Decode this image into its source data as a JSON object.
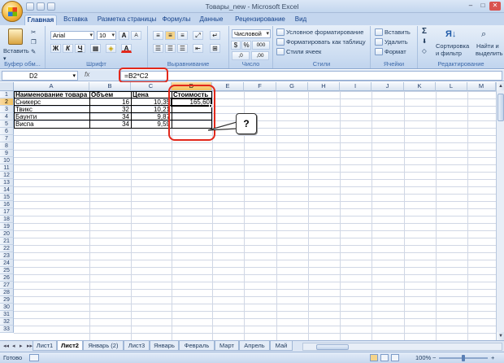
{
  "window": {
    "title": "Товары_new - Microsoft Excel",
    "controls": [
      "–",
      "□",
      "✕"
    ]
  },
  "tabs": [
    "Главная",
    "Вставка",
    "Разметка страницы",
    "Формулы",
    "Данные",
    "Рецензирование",
    "Вид"
  ],
  "ribbon": {
    "clipboard": {
      "paste": "Вставить",
      "label": "Буфер обм..."
    },
    "font": {
      "name": "Arial",
      "size": "10",
      "bold": "Ж",
      "italic": "К",
      "underline": "Ч",
      "grow": "A",
      "shrink": "A",
      "color_letter": "A",
      "label": "Шрифт"
    },
    "alignment": {
      "label": "Выравнивание"
    },
    "number": {
      "format": "Числовой",
      "percent": "%",
      "thousands": "000",
      "inc_dec": ",0",
      "dec_dec": ",00",
      "label": "Число"
    },
    "styles": {
      "conditional": "Условное форматирование",
      "table": "Форматировать как таблицу",
      "cell": "Стили ячеек",
      "label": "Стили"
    },
    "cells": {
      "insert": "Вставить",
      "delete": "Удалить",
      "format": "Формат",
      "label": "Ячейки"
    },
    "editing": {
      "sum": "Σ",
      "sort_line1": "Сортировка",
      "sort_line2": "и фильтр",
      "find_line1": "Найти и",
      "find_line2": "выделить",
      "label": "Редактирование"
    }
  },
  "formula_bar": {
    "cell": "D2",
    "fx": "fx",
    "formula": "=B2*C2"
  },
  "columns": [
    "A",
    "B",
    "C",
    "D",
    "E",
    "F",
    "G",
    "H",
    "I",
    "J",
    "K",
    "L",
    "M"
  ],
  "rows": [
    "1",
    "2",
    "3",
    "4",
    "5",
    "6",
    "7",
    "8",
    "9",
    "10",
    "11",
    "12",
    "13",
    "14",
    "15",
    "16",
    "17",
    "18",
    "19",
    "20",
    "21",
    "22",
    "23",
    "24",
    "25",
    "26",
    "27",
    "28",
    "29",
    "30",
    "31",
    "32",
    "33"
  ],
  "table": {
    "headers": [
      "Наименование товара",
      "Объем",
      "Цена",
      "Стоимость"
    ],
    "rows": [
      {
        "name": "Сникерс",
        "volume": "16",
        "price": "10,35",
        "cost": "165,60"
      },
      {
        "name": "Твикс",
        "volume": "32",
        "price": "10,21",
        "cost": ""
      },
      {
        "name": "Баунти",
        "volume": "34",
        "price": "9,87",
        "cost": ""
      },
      {
        "name": "Виспа",
        "volume": "34",
        "price": "9,59",
        "cost": ""
      }
    ]
  },
  "callout": "?",
  "sheets": [
    "Лист1",
    "Лист2",
    "Январь (2)",
    "Лист3",
    "Январь",
    "Февраль",
    "Март",
    "Апрель",
    "Май"
  ],
  "active_sheet": "Лист2",
  "status": {
    "ready": "Готово",
    "zoom": "100%",
    "zoom_minus": "−",
    "zoom_plus": "+"
  },
  "colors": {
    "accent": "#e2281b",
    "ribbon": "#cbdcf1",
    "selected_header": "#f1c15f"
  }
}
